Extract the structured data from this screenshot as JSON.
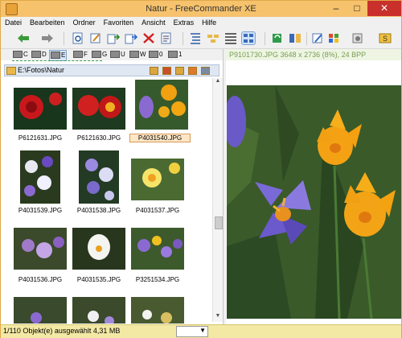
{
  "window": {
    "title": "Natur - FreeCommander XE"
  },
  "menu": [
    "Datei",
    "Bearbeiten",
    "Ordner",
    "Favoriten",
    "Ansicht",
    "Extras",
    "Hilfe"
  ],
  "drives": [
    "C",
    "D",
    "E",
    "F",
    "G",
    "U",
    "W",
    "0",
    "1"
  ],
  "path": "E:\\Fotos\\Natur",
  "preview_header": "P9101730.JPG   3648 x 2736 (8%), 24 BPP",
  "files": [
    {
      "name": "P6121631.JPG"
    },
    {
      "name": "P6121630.JPG"
    },
    {
      "name": "P4031540.JPG",
      "selected": true
    },
    {
      "name": "P4031539.JPG"
    },
    {
      "name": "P4031538.JPG"
    },
    {
      "name": "P4031537.JPG"
    },
    {
      "name": "P4031536.JPG"
    },
    {
      "name": "P4031535.JPG"
    },
    {
      "name": "P3251534.JPG"
    }
  ],
  "status": {
    "text": "1/110 Objekt(e) ausgewählt   4,31 MB"
  },
  "colors": {
    "titlebar": "#f6c26c",
    "close": "#c9302c",
    "status": "#f3e9a4",
    "preview_head": "#7a9b55"
  }
}
